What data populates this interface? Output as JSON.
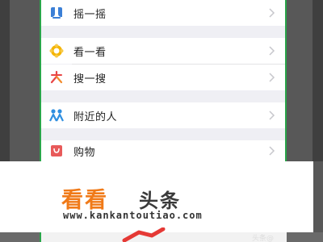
{
  "menu": {
    "items": [
      {
        "label": "摇一摇",
        "icon": "shake-icon",
        "color": "#3b7fd6"
      },
      {
        "label": "看一看",
        "icon": "look-icon",
        "color": "#f4b400"
      },
      {
        "label": "搜一搜",
        "icon": "search-star-icon",
        "color": "#e84545"
      },
      {
        "label": "附近的人",
        "icon": "nearby-people-icon",
        "color": "#2f8fe0"
      },
      {
        "label": "购物",
        "icon": "shopping-bag-icon",
        "color": "#e85a5a"
      }
    ]
  },
  "watermark": {
    "orange_text": "看看",
    "dark_text": "头条",
    "url": "www.kankantoutiao.com"
  },
  "corner": {
    "text": "头条@"
  },
  "colors": {
    "accent_border": "#2aa44a",
    "list_background": "#efeff4",
    "brand_orange": "#f07a18"
  }
}
